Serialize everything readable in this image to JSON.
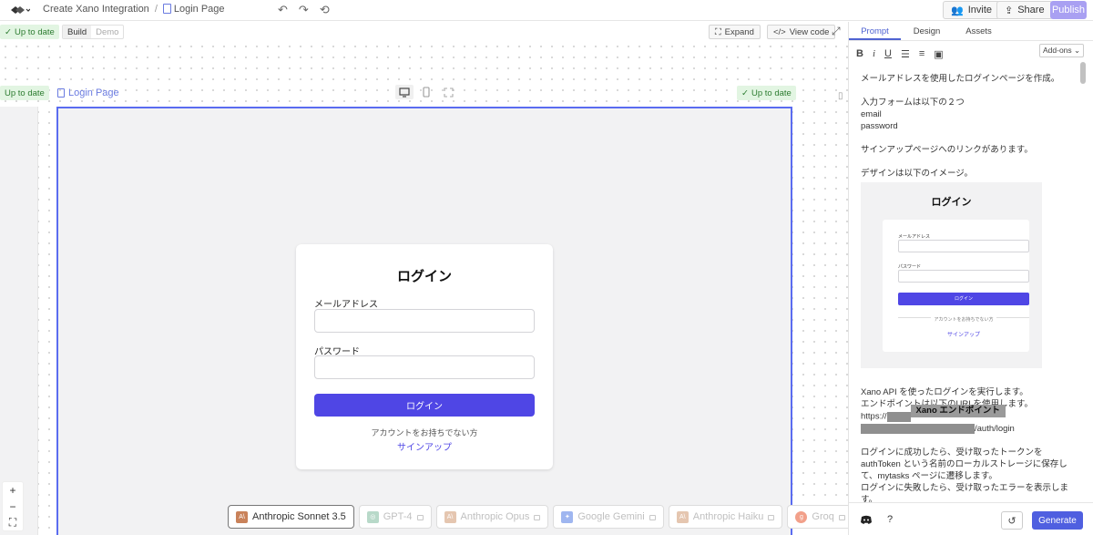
{
  "header": {
    "breadcrumb_project": "Create Xano Integration",
    "breadcrumb_sep": "/",
    "breadcrumb_page": "Login Page",
    "undo_icon": "undo-icon",
    "redo_icon": "redo-icon",
    "history_icon": "history-icon",
    "invite_label": "Invite",
    "share_label": "Share",
    "publish_label": "Publish"
  },
  "subbar": {
    "status": "Up to date",
    "mode_build": "Build",
    "mode_demo": "Demo",
    "expand_label": "Expand",
    "view_code_label": "View code"
  },
  "canvas": {
    "prev_frame_status": "Up to date",
    "frame_title": "Login Page",
    "frame_status": "Up to date",
    "zoom_in": "+",
    "zoom_out": "−",
    "fit": "⛶"
  },
  "login_card": {
    "title": "ログイン",
    "email_label": "メールアドレス",
    "password_label": "パスワード",
    "submit_label": "ログイン",
    "no_account_text": "アカウントをお持ちでない方",
    "signup_link": "サインアップ"
  },
  "models": [
    {
      "name": "Anthropic Sonnet 3.5",
      "icon": "A\\",
      "color": "#c9825a",
      "selected": true
    },
    {
      "name": "GPT-4",
      "icon": "◎",
      "color": "#b8d9c9",
      "selected": false
    },
    {
      "name": "Anthropic Opus",
      "icon": "A\\",
      "color": "#e5c6b0",
      "selected": false
    },
    {
      "name": "Google Gemini",
      "icon": "✦",
      "color": "#9fb6f0",
      "selected": false
    },
    {
      "name": "Anthropic Haiku",
      "icon": "A\\",
      "color": "#e5c6b0",
      "selected": false
    },
    {
      "name": "Groq",
      "icon": "g",
      "color": "#f2a08a",
      "selected": false
    }
  ],
  "panel": {
    "tabs": [
      "Prompt",
      "Design",
      "Assets"
    ],
    "active_tab": "Prompt",
    "addons_label": "Add-ons",
    "prompt_p1": "メールアドレスを使用したログインページを作成。",
    "prompt_p2_l1": "入力フォームは以下の２つ",
    "prompt_p2_l2": "email",
    "prompt_p2_l3": "password",
    "prompt_p3": "サインアップページへのリンクがあります。",
    "prompt_p4": "デザインは以下のイメージ。",
    "mock_title": "ログイン",
    "mock_email": "メールアドレス",
    "mock_password": "パスワード",
    "mock_button": "ログイン",
    "mock_note": "アカウントをお持ちでない方",
    "mock_link": "サインアップ",
    "prompt_p5_l1": "Xano API を使ったログインを実行します。",
    "prompt_p5_l2": "エンドポイントは以下のURLを使用します。",
    "prompt_p5_l3": "https://",
    "redaction_label": "Xano エンドポイント",
    "prompt_p5_l4": "/auth/login",
    "prompt_p6_l1": "ログインに成功したら、受け取ったトークンを",
    "prompt_p6_l2": "authToken という名前のローカルストレージに保存して、mytasks ページに遷移します。",
    "prompt_p6_l3": "ログインに失敗したら、受け取ったエラーを表示します。",
    "help_label": "?",
    "generate_label": "Generate"
  }
}
